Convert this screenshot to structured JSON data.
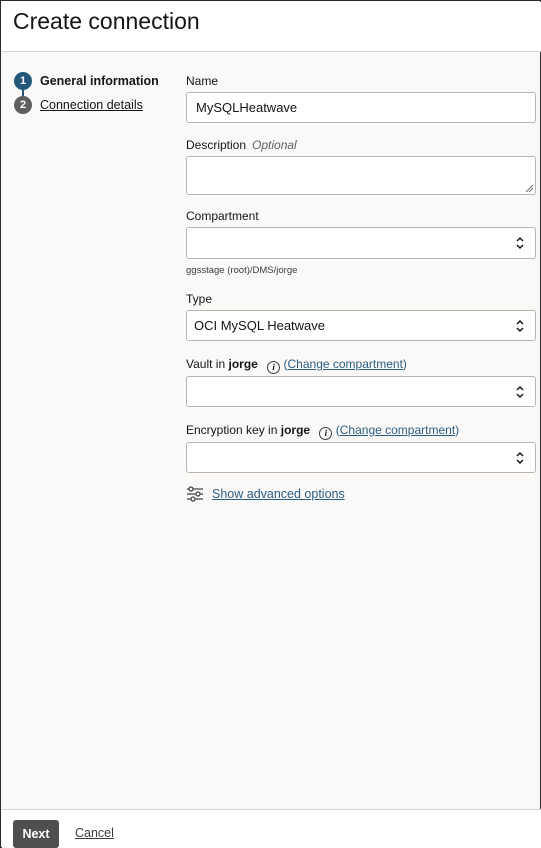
{
  "dialog": {
    "title": "Create connection"
  },
  "steps": [
    {
      "number": "1",
      "label": "General information"
    },
    {
      "number": "2",
      "label": "Connection details"
    }
  ],
  "form": {
    "name": {
      "label": "Name",
      "value": "MySQLHeatwave"
    },
    "description": {
      "label": "Description",
      "optional": "Optional",
      "value": ""
    },
    "compartment": {
      "label": "Compartment",
      "value": "",
      "hint": "ggsstage (root)/DMS/jorge"
    },
    "type": {
      "label": "Type",
      "value": "OCI MySQL Heatwave"
    },
    "vault": {
      "label_prefix": "Vault in",
      "label_bold": "jorge",
      "info": "i",
      "change_link": "Change compartment",
      "value": ""
    },
    "encryption_key": {
      "label_prefix": "Encryption key in",
      "label_bold": "jorge",
      "info": "i",
      "change_link": "Change compartment",
      "value": ""
    },
    "advanced": {
      "label": "Show advanced options",
      "icon": "sliders-icon"
    }
  },
  "footer": {
    "next_label": "Next",
    "cancel_label": "Cancel"
  },
  "colors": {
    "accent": "#22577a",
    "link": "#2a5d84",
    "button": "#4f4f4f"
  }
}
